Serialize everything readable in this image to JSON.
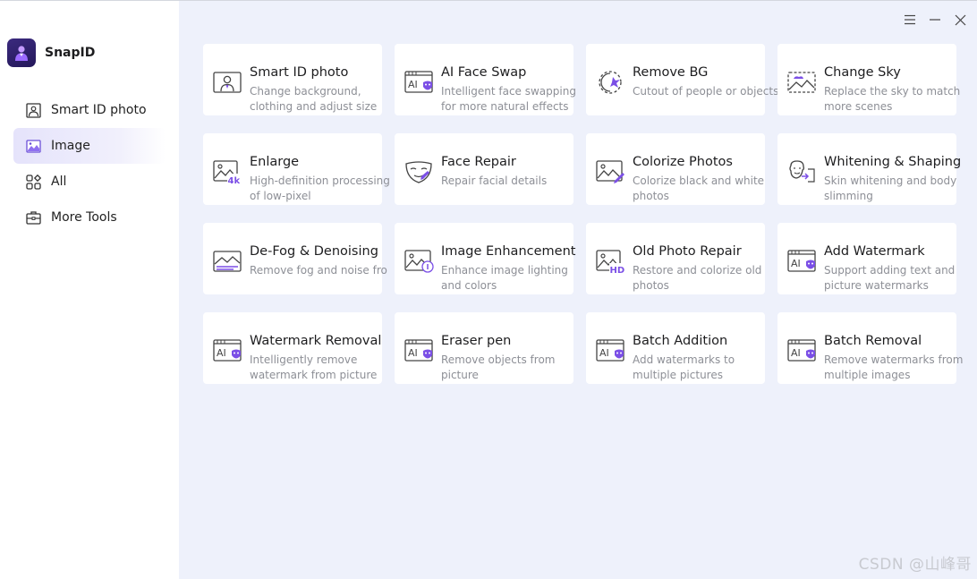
{
  "app": {
    "name": "SnapID"
  },
  "colors": {
    "accent": "#7b4fe6",
    "active_bg": "#e5e3fb",
    "content_bg": "#eef1fb"
  },
  "sidebar": {
    "items": [
      {
        "label": "Smart ID photo",
        "icon": "id-photo-icon"
      },
      {
        "label": "Image",
        "icon": "image-icon",
        "active": true
      },
      {
        "label": "All",
        "icon": "grid-icon"
      },
      {
        "label": "More Tools",
        "icon": "toolbox-icon"
      }
    ]
  },
  "window": {
    "menu": "menu-icon",
    "minimize": "minimize-icon",
    "close": "close-icon"
  },
  "tools": [
    {
      "title": "Smart ID photo",
      "desc": "Change background, clothing and adjust size",
      "icon": "id-photo-icon"
    },
    {
      "title": "AI Face Swap",
      "desc": "Intelligent face swapping for more natural effects",
      "icon": "ai-face-icon"
    },
    {
      "title": "Remove BG",
      "desc": "Cutout of people or objects",
      "icon": "remove-bg-icon"
    },
    {
      "title": "Change Sky",
      "desc": "Replace the sky to match more scenes",
      "icon": "sky-icon"
    },
    {
      "title": "Enlarge",
      "desc": "High-definition processing of low-pixel",
      "icon": "enlarge-4k-icon"
    },
    {
      "title": "Face Repair",
      "desc": "Repair facial details",
      "icon": "mask-icon"
    },
    {
      "title": "Colorize Photos",
      "desc": "Colorize black and white photos",
      "icon": "colorize-icon"
    },
    {
      "title": "Whitening & Shaping",
      "desc": "Skin whitening and body slimming",
      "icon": "face-shape-icon"
    },
    {
      "title": "De-Fog & Denoising",
      "desc": "Remove fog and noise fro",
      "icon": "defog-icon"
    },
    {
      "title": "Image Enhancement",
      "desc": "Enhance image lighting and colors",
      "icon": "enhance-icon"
    },
    {
      "title": "Old Photo Repair",
      "desc": "Restore and colorize old photos",
      "icon": "hd-photo-icon"
    },
    {
      "title": "Add Watermark",
      "desc": "Support adding text and picture watermarks",
      "icon": "ai-watermark-icon"
    },
    {
      "title": "Watermark Removal",
      "desc": "Intelligently remove watermark from picture",
      "icon": "ai-watermark-icon"
    },
    {
      "title": "Eraser pen",
      "desc": "Remove objects from picture",
      "icon": "ai-watermark-icon"
    },
    {
      "title": "Batch Addition",
      "desc": "Add watermarks to multiple pictures",
      "icon": "ai-watermark-icon"
    },
    {
      "title": "Batch Removal",
      "desc": "Remove watermarks from multiple images",
      "icon": "ai-watermark-icon"
    }
  ],
  "footer_watermark": "CSDN @山峰哥"
}
